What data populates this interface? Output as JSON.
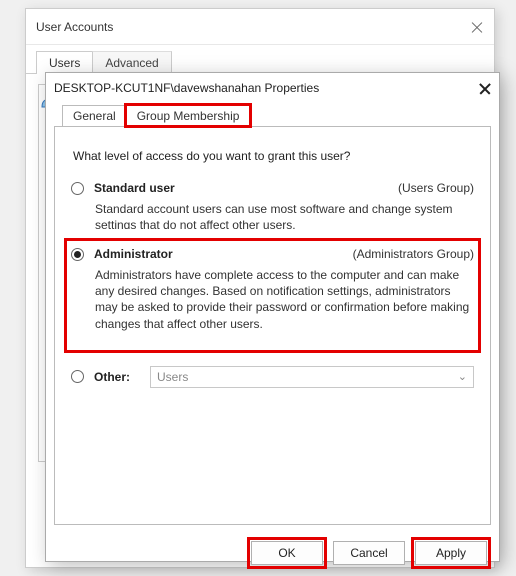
{
  "outer": {
    "title": "User Accounts",
    "tabs": {
      "users": "Users",
      "advanced": "Advanced"
    }
  },
  "inner": {
    "title": "DESKTOP-KCUT1NF\\davewshanahan Properties",
    "tabs": {
      "general": "General",
      "group": "Group Membership"
    },
    "prompt": "What level of access do you want to grant this user?",
    "standard": {
      "label": "Standard user",
      "group": "(Users Group)",
      "desc": "Standard account users can use most software and change system settings that do not affect other users."
    },
    "admin": {
      "label": "Administrator",
      "group": "(Administrators Group)",
      "desc": "Administrators have complete access to the computer and can make any desired changes. Based on notification settings, administrators may be asked to provide their password or confirmation before making changes that affect other users."
    },
    "other": {
      "label": "Other:",
      "value": "Users"
    },
    "buttons": {
      "ok": "OK",
      "cancel": "Cancel",
      "apply": "Apply"
    }
  }
}
